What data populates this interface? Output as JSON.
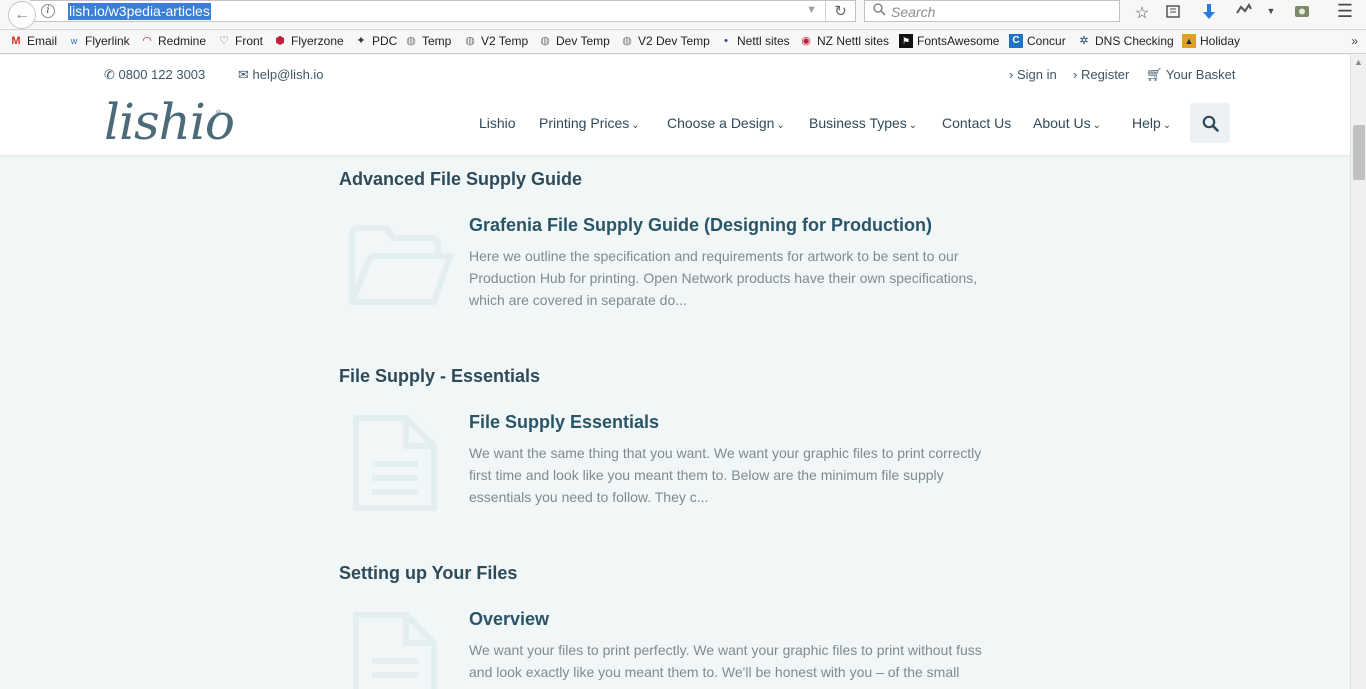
{
  "browser": {
    "url": "lish.io/w3pedia-articles",
    "search_placeholder": "Search"
  },
  "bookmarks": [
    {
      "label": "Email",
      "icon": "gmail-icon",
      "color": "#d93025"
    },
    {
      "label": "Flyerlink",
      "icon": "flyerlink-icon",
      "color": "#2d6fb5"
    },
    {
      "label": "Redmine",
      "icon": "redmine-icon",
      "color": "#b32024"
    },
    {
      "label": "Front",
      "icon": "shield-icon",
      "color": "#555555"
    },
    {
      "label": "Flyerzone",
      "icon": "flyerzone-icon",
      "color": "#c0203a"
    },
    {
      "label": "PDC",
      "icon": "pdc-icon",
      "color": "#333333"
    },
    {
      "label": "Temp",
      "icon": "globe-icon",
      "color": "#777777"
    },
    {
      "label": "V2 Temp",
      "icon": "globe-icon",
      "color": "#777777"
    },
    {
      "label": "Dev Temp",
      "icon": "globe-icon",
      "color": "#777777"
    },
    {
      "label": "V2 Dev Temp",
      "icon": "globe-icon",
      "color": "#777777"
    },
    {
      "label": "Nettl sites",
      "icon": "nettl-icon",
      "color": "#2b3a8f"
    },
    {
      "label": "NZ Nettl sites",
      "icon": "nettl-nz-icon",
      "color": "#c0203a"
    },
    {
      "label": "FontsAwesome",
      "icon": "fontawesome-icon",
      "color": "#111111"
    },
    {
      "label": "Concur",
      "icon": "concur-icon",
      "color": "#1a73c8"
    },
    {
      "label": "DNS Checking",
      "icon": "dns-icon",
      "color": "#1c3f6e"
    },
    {
      "label": "Holiday",
      "icon": "holiday-icon",
      "color": "#e0a020"
    }
  ],
  "site": {
    "phone": "0800 122 3003",
    "email": "help@lish.io",
    "sign_in": "Sign in",
    "register": "Register",
    "basket": "Your Basket",
    "logo": "lishio",
    "nav": [
      {
        "label": "Lishio",
        "dropdown": false
      },
      {
        "label": "Printing Prices",
        "dropdown": true
      },
      {
        "label": "Choose a Design",
        "dropdown": true
      },
      {
        "label": "Business Types",
        "dropdown": true
      },
      {
        "label": "Contact Us",
        "dropdown": false
      },
      {
        "label": "About Us",
        "dropdown": true
      },
      {
        "label": "Help",
        "dropdown": true
      }
    ]
  },
  "sections": [
    {
      "title": "Advanced File Supply Guide",
      "card": {
        "icon": "folder-open-icon",
        "title": "Grafenia File Supply Guide (Designing for Production)",
        "text": "Here we outline the specification and requirements for artwork to be sent to our Production Hub for printing. Open Network products have their own specifications, which are covered in separate do..."
      }
    },
    {
      "title": "File Supply - Essentials",
      "card": {
        "icon": "document-icon",
        "title": "File Supply Essentials",
        "text": "We want the same thing that you want. We want your graphic files to print correctly first time and look like you meant them to. Below are the minimum file supply essentials you need to follow. They c..."
      }
    },
    {
      "title": "Setting up Your Files",
      "card": {
        "icon": "document-icon",
        "title": "Overview",
        "text": "We want your files to print perfectly. We want your graphic files to print without fuss and look exactly like you meant them to. We'll be honest with you – of the small number of jobs that don't..."
      }
    }
  ],
  "colors": {
    "accent": "#2f4a59",
    "page_bg": "#f1f6f6",
    "icon_faint": "#e3eeee"
  }
}
